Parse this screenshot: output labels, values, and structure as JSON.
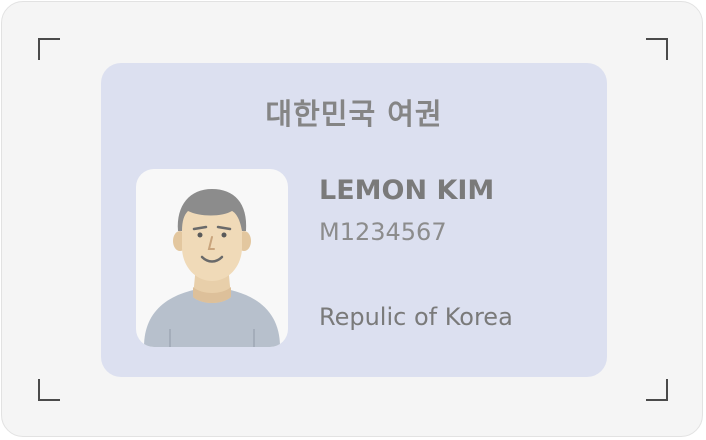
{
  "passport": {
    "title": "대한민국 여권",
    "holder_name": "LEMON KIM",
    "passport_number": "M1234567",
    "country": "Repulic of Korea"
  },
  "icons": {
    "photo": "person-avatar-icon",
    "scan_corners": "scan-frame-corner-icon"
  },
  "colors": {
    "background": "#f5f5f5",
    "card": "#dce0f0",
    "corner": "#4a4a4a",
    "title_text": "#858585",
    "body_text": "#7a7a7a"
  }
}
